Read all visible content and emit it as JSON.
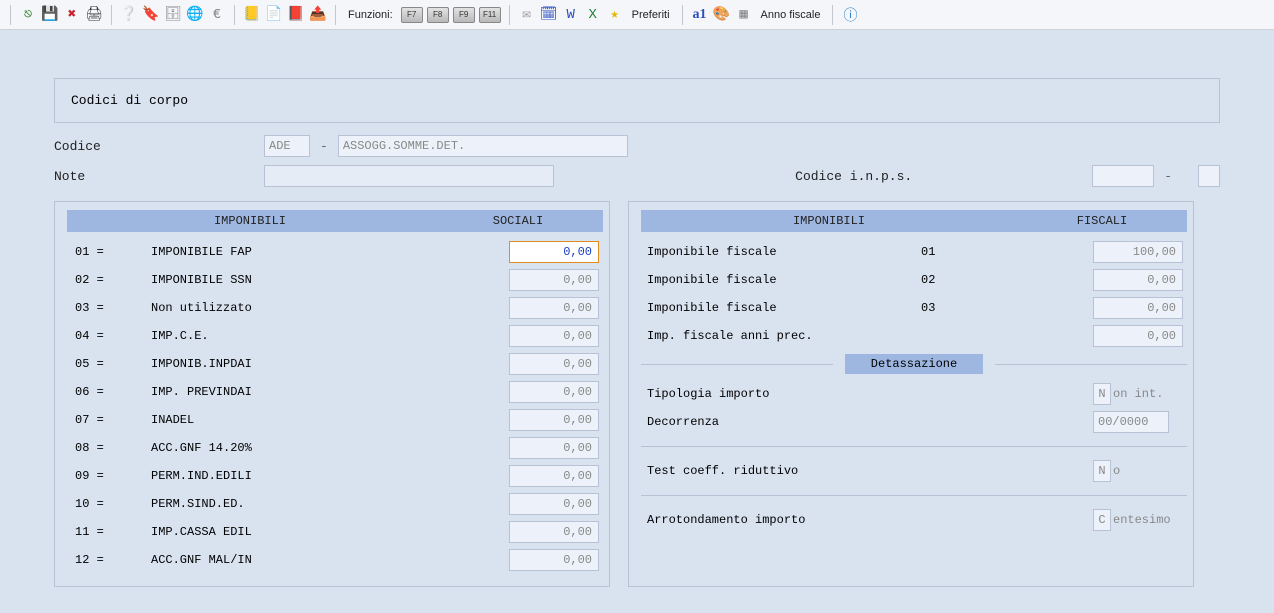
{
  "toolbar": {
    "funzioni_label": "Funzioni:",
    "fkeys": [
      "F7",
      "F8",
      "F9",
      "F11"
    ],
    "preferiti": "Preferiti",
    "anno_fiscale": "Anno fiscale"
  },
  "panel": {
    "title": "Codici di corpo"
  },
  "form": {
    "codice_label": "Codice",
    "codice_value": "ADE",
    "codice_dash": "-",
    "codice_desc": "ASSOGG.SOMME.DET.",
    "note_label": "Note",
    "note_value": "",
    "inps_label": "Codice i.n.p.s.",
    "inps_dash": "-"
  },
  "left": {
    "hdr_l": "IMPONIBILI",
    "hdr_r": "SOCIALI",
    "rows": [
      {
        "code": "01 =",
        "name": "IMPONIBILE FAP",
        "val": "0,00",
        "active": true
      },
      {
        "code": "02 =",
        "name": "IMPONIBILE SSN",
        "val": "0,00"
      },
      {
        "code": "03 =",
        "name": "Non utilizzato",
        "val": "0,00"
      },
      {
        "code": "04 =",
        "name": "IMP.C.E.",
        "val": "0,00"
      },
      {
        "code": "05 =",
        "name": "IMPONIB.INPDAI",
        "val": "0,00"
      },
      {
        "code": "06 =",
        "name": "IMP. PREVINDAI",
        "val": "0,00"
      },
      {
        "code": "07 =",
        "name": "INADEL",
        "val": "0,00"
      },
      {
        "code": "08 =",
        "name": "ACC.GNF 14.20%",
        "val": "0,00"
      },
      {
        "code": "09 =",
        "name": "PERM.IND.EDILI",
        "val": "0,00"
      },
      {
        "code": "10 =",
        "name": "PERM.SIND.ED.",
        "val": "0,00"
      },
      {
        "code": "11 =",
        "name": "IMP.CASSA EDIL",
        "val": "0,00"
      },
      {
        "code": "12 =",
        "name": "ACC.GNF MAL/IN",
        "val": "0,00"
      }
    ]
  },
  "right": {
    "hdr_l": "IMPONIBILI",
    "hdr_r": "FISCALI",
    "fiscali": [
      {
        "name": "Imponibile fiscale",
        "code": "01",
        "val": "100,00"
      },
      {
        "name": "Imponibile fiscale",
        "code": "02",
        "val": "0,00"
      },
      {
        "name": "Imponibile fiscale",
        "code": "03",
        "val": "0,00"
      },
      {
        "name": "Imp. fiscale anni prec.",
        "code": "",
        "val": "0,00"
      }
    ],
    "detassazione_label": "Detassazione",
    "tipologia_label": "Tipologia importo",
    "tipologia_char": "N",
    "tipologia_rest": "on int.",
    "decorrenza_label": "Decorrenza",
    "decorrenza_val": "00/0000",
    "test_label": "Test coeff. riduttivo",
    "test_char": "N",
    "test_rest": "o",
    "arr_label": "Arrotondamento importo",
    "arr_char": "C",
    "arr_rest": "entesimo"
  }
}
